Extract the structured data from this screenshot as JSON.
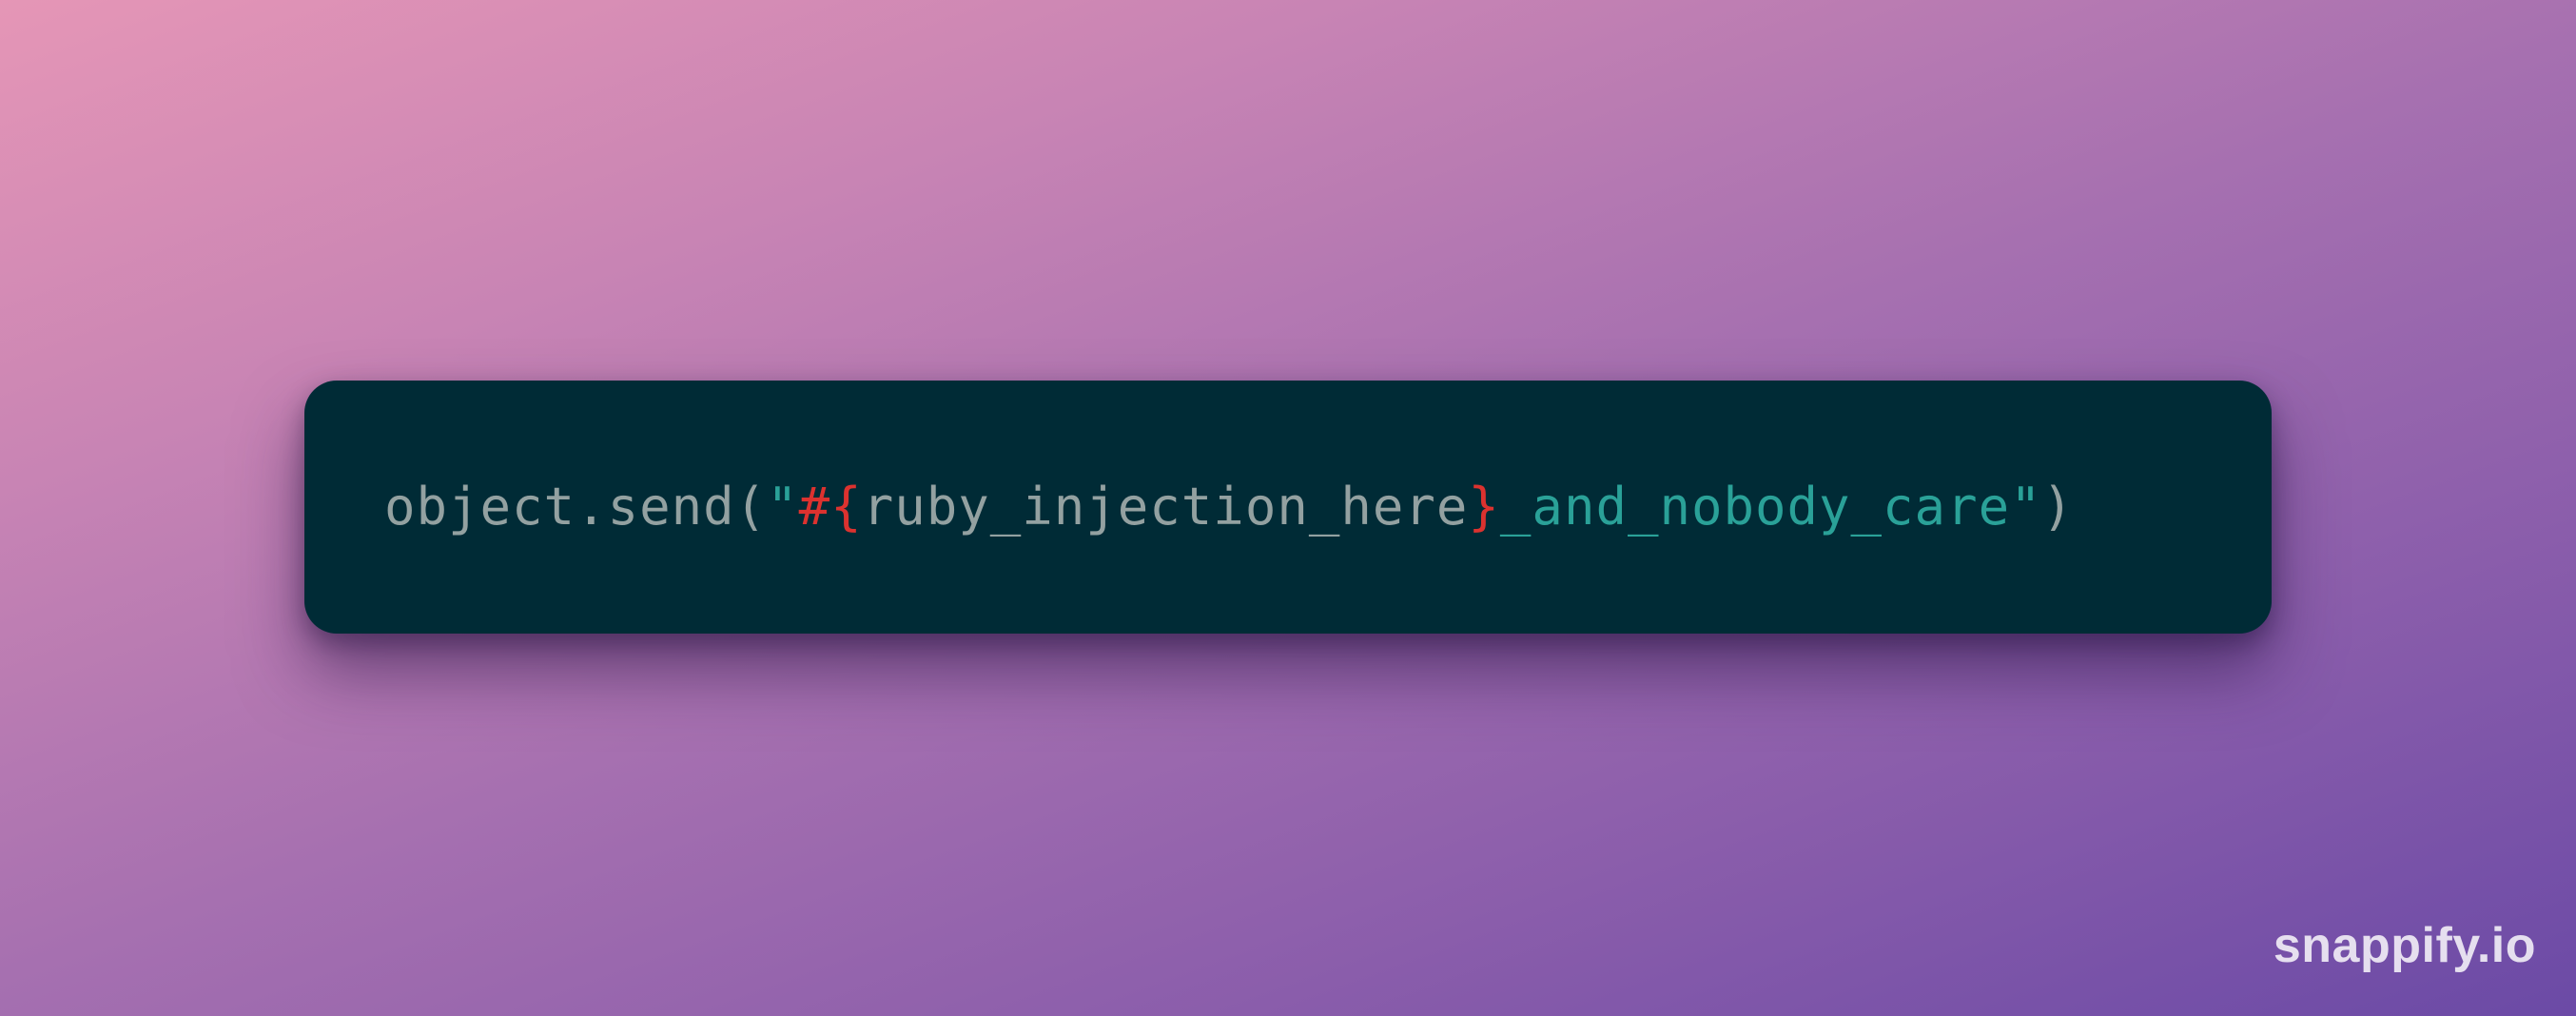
{
  "code": {
    "tokens": [
      {
        "text": "object.send(",
        "kind": "plain"
      },
      {
        "text": "\"",
        "kind": "string"
      },
      {
        "text": "#{",
        "kind": "interpolation"
      },
      {
        "text": "ruby_injection_here",
        "kind": "plain"
      },
      {
        "text": "}",
        "kind": "interpolation"
      },
      {
        "text": "_and_nobody_care",
        "kind": "string"
      },
      {
        "text": "\"",
        "kind": "string"
      },
      {
        "text": ")",
        "kind": "plain"
      }
    ]
  },
  "watermark": "snappify.io",
  "colors": {
    "card_background": "#002b36",
    "plain_text": "#93a1a1",
    "string": "#2aa198",
    "interpolation": "#dc322f"
  }
}
